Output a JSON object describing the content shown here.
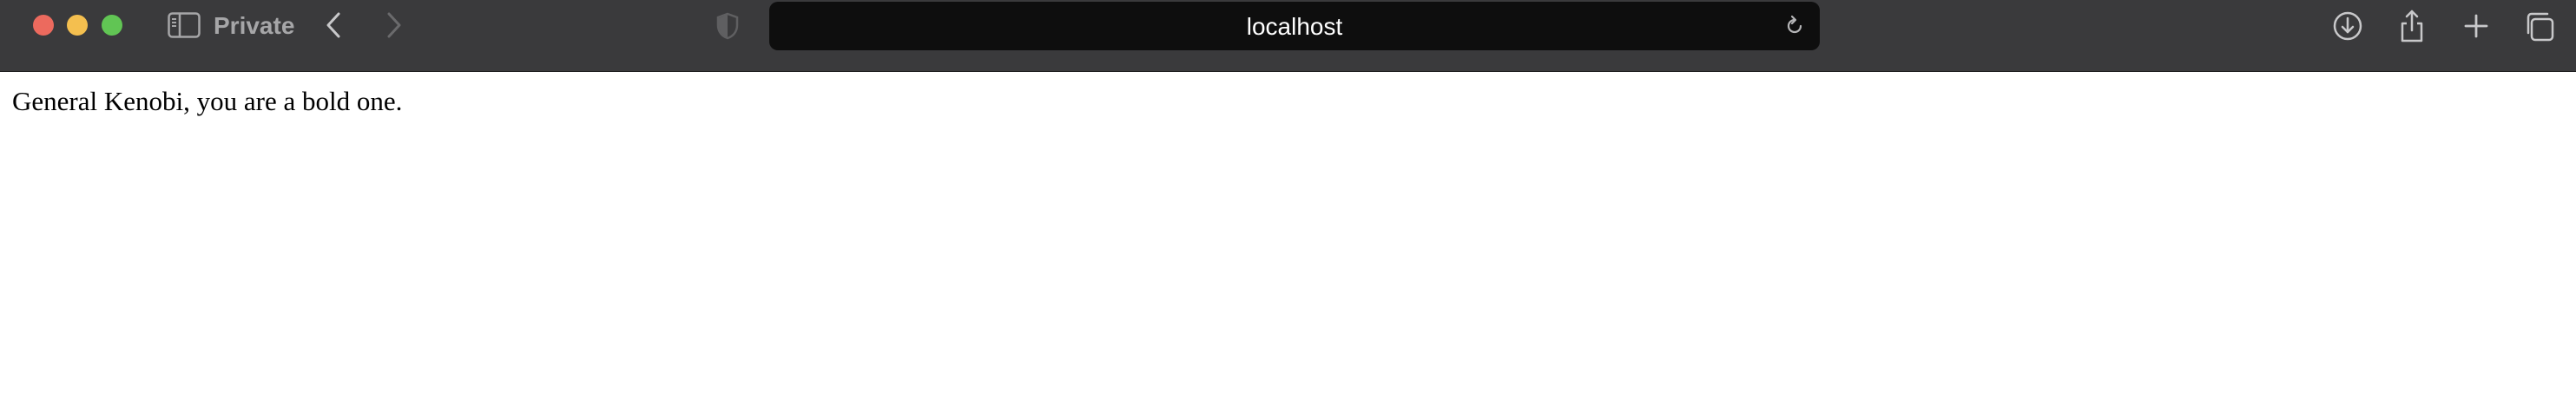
{
  "browser": {
    "mode_label": "Private",
    "address": "localhost",
    "colors": {
      "toolbar": "#3a3a3c",
      "address_bar": "#0e0e0e",
      "close": "#ec6a5e",
      "minimize": "#f4bf4f",
      "maximize": "#61c554"
    },
    "icons": {
      "sidebar": "sidebar-icon",
      "back": "chevron-left-icon",
      "forward": "chevron-right-icon",
      "privacy": "shield-icon",
      "reload": "reload-icon",
      "download": "download-icon",
      "share": "share-icon",
      "new_tab": "plus-icon",
      "tab_overview": "tabs-overview-icon"
    }
  },
  "page": {
    "body_text": "General Kenobi, you are a bold one."
  }
}
